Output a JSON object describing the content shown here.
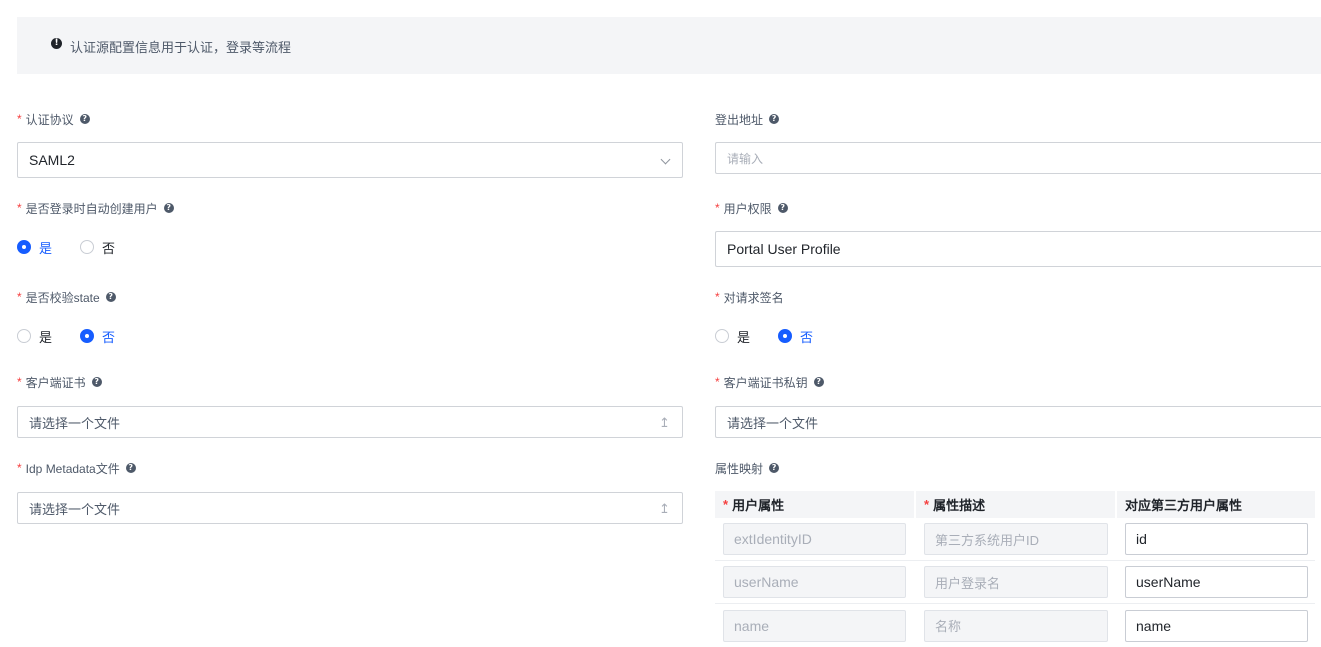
{
  "alert": {
    "text": "认证源配置信息用于认证，登录等流程",
    "icon": "!"
  },
  "help_glyph": "?",
  "required_mark": "*",
  "fields": {
    "protocol": {
      "label": "认证协议",
      "value": "SAML2"
    },
    "logout_url": {
      "label": "登出地址",
      "placeholder": "请输入"
    },
    "auto_create": {
      "label": "是否登录时自动创建用户",
      "options": [
        "是",
        "否"
      ],
      "selected": "是"
    },
    "permission": {
      "label": "用户权限",
      "value": "Portal User Profile"
    },
    "verify_state": {
      "label": "是否校验state",
      "options": [
        "是",
        "否"
      ],
      "selected": "否"
    },
    "sign_request": {
      "label": "对请求签名",
      "options": [
        "是",
        "否"
      ],
      "selected": "否"
    },
    "client_cert": {
      "label": "客户端证书",
      "file_text": "请选择一个文件"
    },
    "client_key": {
      "label": "客户端证书私钥",
      "file_text": "请选择一个文件"
    },
    "idp_metadata": {
      "label": "Idp Metadata文件",
      "file_text": "请选择一个文件"
    },
    "attr_mapping": {
      "label": "属性映射"
    }
  },
  "mapping": {
    "headers": [
      "用户属性",
      "属性描述",
      "对应第三方用户属性"
    ],
    "rows": [
      {
        "attr": "extIdentityID",
        "desc": "第三方系统用户ID",
        "third": "id"
      },
      {
        "attr": "userName",
        "desc": "用户登录名",
        "third": "userName"
      },
      {
        "attr": "name",
        "desc": "名称",
        "third": "name"
      }
    ]
  },
  "icons": {
    "upload": "↥",
    "alert": "exclamation-icon",
    "help": "question-icon"
  },
  "colors": {
    "primary": "#165dff",
    "required": "#f53f3f"
  }
}
